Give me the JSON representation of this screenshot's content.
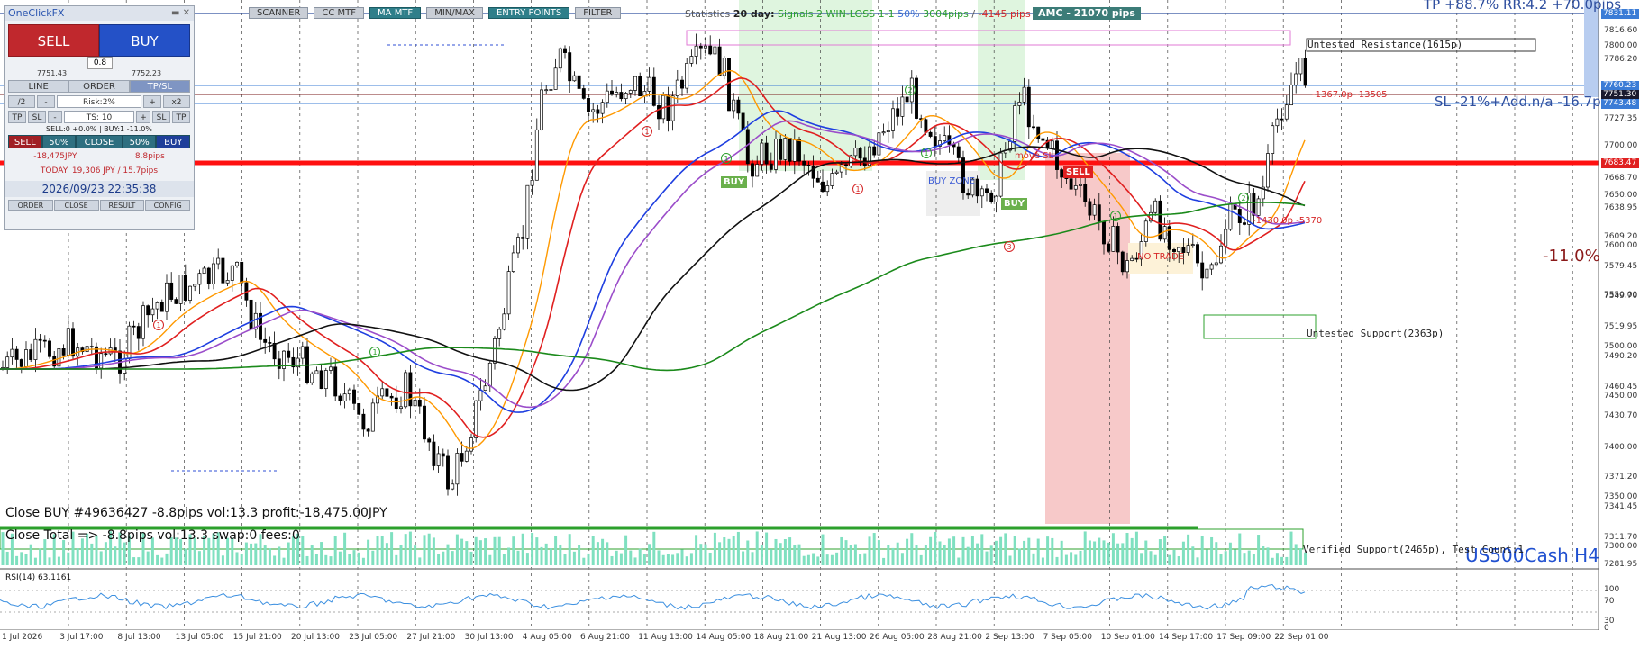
{
  "panel": {
    "title": "OneClickFX",
    "sell_label": "SELL",
    "buy_label": "BUY",
    "lot": "0.8",
    "sell_price": "7751.43",
    "buy_price": "7752.23",
    "mode_tabs": [
      "LINE",
      "ORDER",
      "TP/SL"
    ],
    "row_half": "/2",
    "row_minus": "-",
    "risk_label": "Risk:2%",
    "row_plus": "+",
    "row_x2": "x2",
    "tp_btn": "TP",
    "sl_btn": "SL",
    "ts_label": "TS: 10",
    "sl_btn2": "SL",
    "tp_btn2": "TP",
    "info_line": "SELL:0 +0.0% | BUY:1 -11.0%",
    "close_row": [
      "SELL",
      "50%",
      "CLOSE",
      "50%",
      "BUY"
    ],
    "pl_jpy": "-18,475JPY",
    "pl_pips": "8.8pips",
    "today": "TODAY: 19,306 JPY / 15.7pips",
    "datetime": "2026/09/23   22:35:38",
    "bottom_buttons": [
      "ORDER",
      "CLOSE",
      "RESULT",
      "CONFIG"
    ]
  },
  "toolbar": {
    "buttons": [
      {
        "label": "SCANNER",
        "active": false
      },
      {
        "label": "CC MTF",
        "active": false
      },
      {
        "label": "MA MTF",
        "active": true
      },
      {
        "label": "MIN/MAX",
        "active": false
      },
      {
        "label": "ENTRY POINTS",
        "active": true
      },
      {
        "label": "FILTER",
        "active": false
      }
    ]
  },
  "stats": {
    "prefix": "Statistics",
    "days": "20 day:",
    "signals": "Signals 2",
    "winloss": "WIN-LOSS 1-1",
    "rate": "50%",
    "pips_pos": "3004pips",
    "sep": "/",
    "pips_neg": "-4145 pips"
  },
  "amc": "AMC - 21070 pips",
  "overlay_texts": {
    "tp": "TP +88.7% RR:4.2 +70.0pips",
    "sl": "SL -21%+Add.n/a -16.7pips",
    "percent": "-11.0%",
    "symbol": "US500Cash H4",
    "resistance": "Untested Resistance(1615p)",
    "support": "Untested Support(2363p)",
    "verified_support": "Verified Support(2465p), Test Count:1",
    "close_buy": "Close BUY #49636427 -8.8pips vol:13.3 profit:-18,475.00JPY",
    "close_total": "Close Total => -8.8pips vol:13.3 swap:0 fees:0",
    "rsi_label": "RSI(14) 63.1161",
    "buy_zone": "BUY ZONE",
    "move_sl": "move SL",
    "no_trade": "NO TRADE",
    "sell_tag": "SELL",
    "buy_tag": "BUY",
    "buy_tag2": "BUY",
    "trade_red": "-1367.0p -13505",
    "trade_red2": "-1430.0p -5370",
    "circle_labels": [
      "1",
      "2",
      "3",
      "1",
      "1",
      "1",
      "1",
      "1",
      "1",
      "2"
    ]
  },
  "price_axis": {
    "labels": [
      "7831.11",
      "7816.60",
      "7800.00",
      "7786.20",
      "7760.23",
      "7751.30",
      "7743.48",
      "7727.35",
      "7700.00",
      "7683.47",
      "7668.70",
      "7650.00",
      "7638.95",
      "7609.20",
      "7600.00",
      "7579.45",
      "7550.00",
      "7549.70",
      "7519.95",
      "7500.00",
      "7490.20",
      "7460.45",
      "7450.00",
      "7430.70",
      "7400.00",
      "7371.20",
      "7350.00",
      "7341.45",
      "7311.70",
      "7300.00",
      "7281.95",
      "100",
      "70",
      "30",
      "0"
    ],
    "tag_colors": {
      "blue": "#3b7cd6",
      "red": "#e02020",
      "dark": "#1a1a2e"
    }
  },
  "date_axis": [
    "1 Jul 2026",
    "3 Jul 17:00",
    "8 Jul 13:00",
    "13 Jul 05:00",
    "15 Jul 21:00",
    "20 Jul 13:00",
    "23 Jul 05:00",
    "27 Jul 21:00",
    "30 Jul 13:00",
    "4 Aug 05:00",
    "6 Aug 21:00",
    "11 Aug 13:00",
    "14 Aug 05:00",
    "18 Aug 21:00",
    "21 Aug 13:00",
    "26 Aug 05:00",
    "28 Aug 21:00",
    "2 Sep 13:00",
    "7 Sep 05:00",
    "10 Sep 01:00",
    "14 Sep 17:00",
    "17 Sep 09:00",
    "22 Sep 01:00"
  ],
  "colors": {
    "bull": "#000000",
    "ma_red": "#e02020",
    "ma_orange": "#ff9900",
    "ma_blue": "#1f3fe0",
    "ma_purple": "#9b4dca",
    "ma_black": "#111111",
    "ma_green": "#1b8a1b",
    "rsi": "#3b8fe0",
    "volume": "#7fe0c0"
  }
}
